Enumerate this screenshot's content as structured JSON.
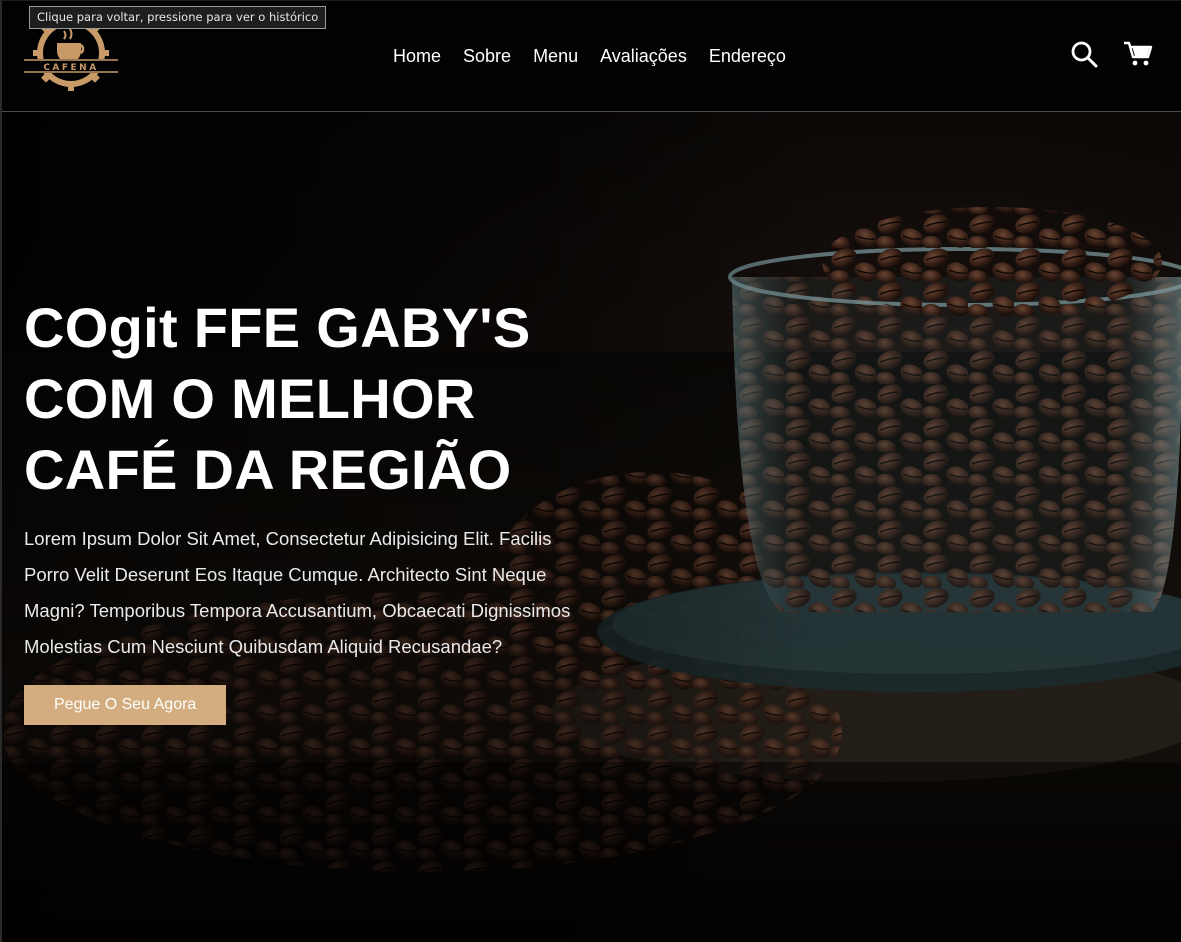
{
  "tooltip": {
    "text": "Clique para voltar, pressione para ver o histórico"
  },
  "brand": {
    "logo_text": "CAFENA",
    "accent": "#d3ad7f"
  },
  "nav": {
    "items": [
      {
        "label": "Home"
      },
      {
        "label": "Sobre"
      },
      {
        "label": "Menu"
      },
      {
        "label": "Avaliações"
      },
      {
        "label": "Endereço"
      }
    ]
  },
  "icons": {
    "search": "search-icon",
    "cart": "cart-icon"
  },
  "hero": {
    "title_lines": [
      "COgit FFE GABY'S",
      "COM O MELHOR",
      "CAFÉ DA REGIÃO"
    ],
    "text_lines": [
      "Lorem Ipsum Dolor Sit Amet, Consectetur Adipisicing Elit. Facilis",
      "Porro Velit Deserunt Eos Itaque Cumque. Architecto Sint Neque",
      "Magni? Temporibus Tempora Accusantium, Obcaecati Dignissimos",
      "Molestias Cum Nesciunt Quibusdam Aliquid Recusandae?"
    ],
    "cta_label": "Pegue O Seu Agora"
  }
}
